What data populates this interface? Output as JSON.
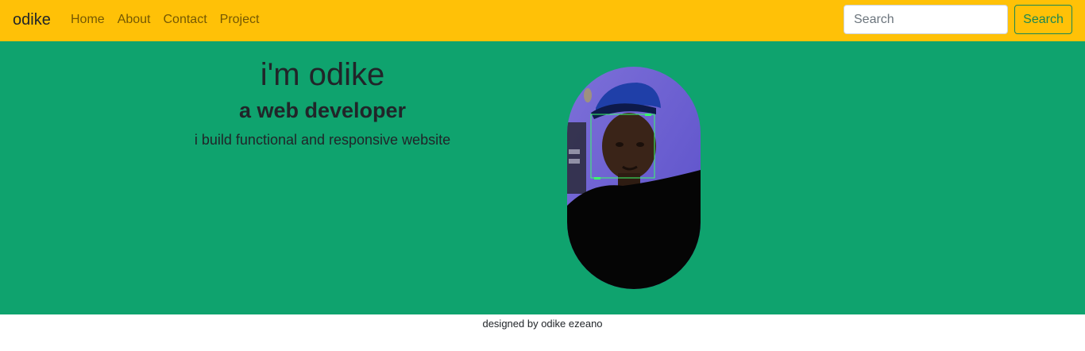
{
  "navbar": {
    "brand": "odike",
    "links": [
      "Home",
      "About",
      "Contact",
      "Project"
    ],
    "search_placeholder": "Search",
    "search_button": "Search",
    "background": "#ffc107"
  },
  "hero": {
    "title": "i'm odike",
    "subtitle": "a web developer",
    "tagline": "i build functional and responsive website",
    "background": "#0fa36e"
  },
  "footer": {
    "text": "designed by odike ezeano"
  }
}
